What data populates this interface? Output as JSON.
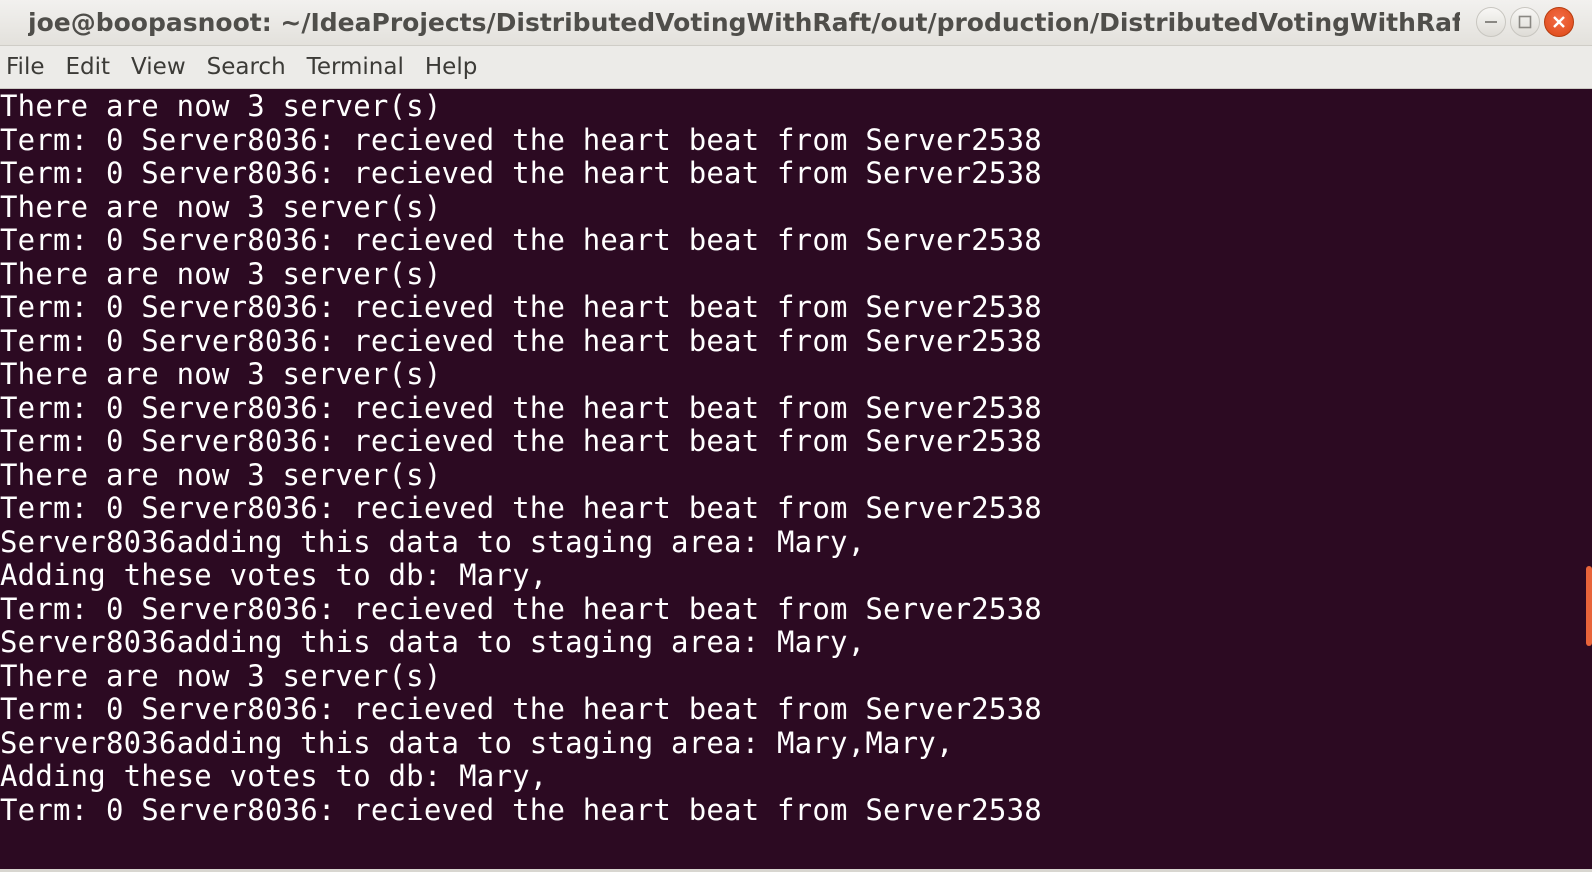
{
  "window": {
    "title": "joe@boopasnoot: ~/IdeaProjects/DistributedVotingWithRaft/out/production/DistributedVotingWithRaft",
    "controls": {
      "minimize_icon": "minimize-icon",
      "maximize_icon": "maximize-icon",
      "close_icon": "close-icon"
    }
  },
  "menubar": {
    "items": [
      {
        "label": "File"
      },
      {
        "label": "Edit"
      },
      {
        "label": "View"
      },
      {
        "label": "Search"
      },
      {
        "label": "Terminal"
      },
      {
        "label": "Help"
      }
    ]
  },
  "terminal": {
    "background": "#2c0a22",
    "foreground": "#ffffff",
    "lines": [
      "There are now 3 server(s)",
      "Term: 0 Server8036: recieved the heart beat from Server2538",
      "Term: 0 Server8036: recieved the heart beat from Server2538",
      "There are now 3 server(s)",
      "Term: 0 Server8036: recieved the heart beat from Server2538",
      "There are now 3 server(s)",
      "Term: 0 Server8036: recieved the heart beat from Server2538",
      "Term: 0 Server8036: recieved the heart beat from Server2538",
      "There are now 3 server(s)",
      "Term: 0 Server8036: recieved the heart beat from Server2538",
      "Term: 0 Server8036: recieved the heart beat from Server2538",
      "There are now 3 server(s)",
      "Term: 0 Server8036: recieved the heart beat from Server2538",
      "Server8036adding this data to staging area: Mary,",
      "Adding these votes to db: Mary,",
      "Term: 0 Server8036: recieved the heart beat from Server2538",
      "Server8036adding this data to staging area: Mary,",
      "There are now 3 server(s)",
      "Term: 0 Server8036: recieved the heart beat from Server2538",
      "Server8036adding this data to staging area: Mary,Mary,",
      "Adding these votes to db: Mary,",
      "Term: 0 Server8036: recieved the heart beat from Server2538"
    ]
  },
  "colors": {
    "accent": "#e8643a",
    "close_button": "#dd4814"
  }
}
